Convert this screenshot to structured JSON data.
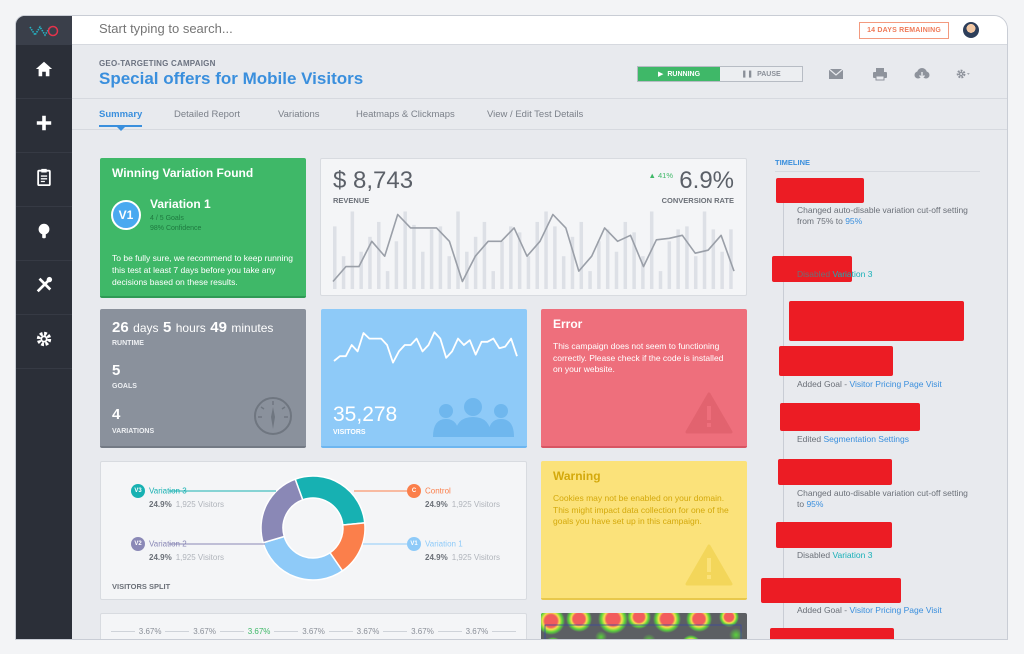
{
  "topbar": {
    "search_placeholder": "Start typing to search...",
    "days_remaining": "14 DAYS REMAINING"
  },
  "header": {
    "campaign_type": "GEO-TARGETING CAMPAIGN",
    "campaign_title": "Special offers for Mobile Visitors",
    "running_label": "RUNNING",
    "pause_label": "PAUSE"
  },
  "sidebar": {
    "items": [
      {
        "icon": "home-icon"
      },
      {
        "icon": "plus-icon"
      },
      {
        "icon": "clipboard-icon"
      },
      {
        "icon": "lightbulb-icon"
      },
      {
        "icon": "tools-icon"
      },
      {
        "icon": "gear-icon"
      }
    ]
  },
  "tabs": [
    {
      "label": "Summary",
      "active": true
    },
    {
      "label": "Detailed Report"
    },
    {
      "label": "Variations"
    },
    {
      "label": "Heatmaps & Clickmaps"
    },
    {
      "label": "View / Edit Test Details"
    }
  ],
  "winning": {
    "title": "Winning Variation Found",
    "badge": "V1",
    "name": "Variation 1",
    "goals": "4 / 5 Goals",
    "confidence": "98% Confidence",
    "message": "To be fully sure, we recommend to keep running this test at least 7 days before you take any decisions based on these results."
  },
  "revenue": {
    "value": "$ 8,743",
    "label": "REVENUE",
    "conversion_value": "6.9%",
    "conversion_label": "CONVERSION RATE",
    "delta": "41%"
  },
  "stats": {
    "runtime_days": "26",
    "runtime_days_unit": "days",
    "runtime_hours": "5",
    "runtime_hours_unit": "hours",
    "runtime_minutes": "49",
    "runtime_minutes_unit": "minutes",
    "runtime_label": "RUNTIME",
    "goals": "5",
    "goals_label": "GOALS",
    "variations": "4",
    "variations_label": "VARIATIONS"
  },
  "visitors": {
    "value": "35,278",
    "label": "VISITORS"
  },
  "error": {
    "title": "Error",
    "message": "This campaign does not seem to functioning correctly. Please check if the code is installed on your website."
  },
  "warning": {
    "title": "Warning",
    "message": "Cookies may not be enabled on your domain. This might impact data collection for one of the goals you have set up in this campaign."
  },
  "split": {
    "label": "VISITORS SPLIT",
    "variations": [
      {
        "badge": "V3",
        "name": "Variation 3",
        "percent": "24.9%",
        "visitors": "1,925 Visitors",
        "color": "#17b1b2"
      },
      {
        "badge": "C",
        "name": "Control",
        "percent": "24.9%",
        "visitors": "1,925 Visitors",
        "color": "#fb7f4b"
      },
      {
        "badge": "V2",
        "name": "Variation 2",
        "percent": "24.9%",
        "visitors": "1,925 Visitors",
        "color": "#8a88b6"
      },
      {
        "badge": "V1",
        "name": "Variation 1",
        "percent": "24.9%",
        "visitors": "1,925 Visitors",
        "color": "#8ecaf8"
      }
    ]
  },
  "percent_row": [
    "3.67%",
    "3.67%",
    "3.67%",
    "3.67%",
    "3.67%",
    "3.67%",
    "3.67%"
  ],
  "timeline": {
    "title": "TIMELINE",
    "items": [
      {
        "text": "Changed auto-disable variation cut-off setting  from 75% to ",
        "link": "95%"
      },
      {
        "text": "Disabled ",
        "link": "Variation 3"
      },
      {
        "text": "Added Goal - ",
        "link": "Visitor Pricing Page Visit"
      },
      {
        "text": "Edited ",
        "link": "Segmentation Settings"
      },
      {
        "text": "Changed auto-disable variation cut-off setting to ",
        "link": "95%"
      },
      {
        "text": "Disabled ",
        "link": "Variation 3"
      },
      {
        "text": "Added Goal - ",
        "link": "Visitor Pricing Page Visit"
      }
    ]
  },
  "colors": {
    "accent": "#3a8fdd",
    "success": "#3fb868",
    "error": "#ee6f7c",
    "warning": "#fbe27a",
    "info": "#8ecaf8",
    "neutral": "#8a919c"
  },
  "chart_data": [
    {
      "type": "line",
      "title": "Revenue",
      "series": [
        {
          "name": "conversion-trend",
          "values": [
            5,
            15,
            15,
            32,
            22,
            50,
            41,
            41,
            41,
            32,
            5,
            22,
            32,
            32,
            41,
            22,
            32,
            50,
            41,
            12,
            22,
            41,
            32,
            36,
            15,
            33,
            34,
            36,
            24,
            26,
            36,
            12
          ]
        },
        {
          "name": "revenue-bars",
          "values": [
            42,
            22,
            52,
            25,
            35,
            45,
            12,
            32,
            52,
            43,
            25,
            40,
            42,
            22,
            52,
            25,
            35,
            45,
            12,
            32,
            42,
            38,
            22,
            45,
            52,
            42,
            22,
            35,
            45,
            12,
            32,
            40,
            25,
            45,
            38,
            22,
            52,
            12,
            32,
            40,
            42,
            22,
            52,
            40,
            25,
            40
          ]
        }
      ]
    },
    {
      "type": "line",
      "title": "Visitors",
      "series": [
        {
          "name": "visitors-trend",
          "values": [
            10,
            16,
            16,
            30,
            22,
            45,
            38,
            38,
            38,
            30,
            8,
            22,
            30,
            30,
            38,
            22,
            30,
            46,
            38,
            14,
            22,
            38,
            30,
            36,
            18,
            34,
            34,
            38,
            26,
            28,
            38,
            16
          ]
        }
      ]
    },
    {
      "type": "pie",
      "title": "VISITORS SPLIT",
      "categories": [
        "Variation 3",
        "Control",
        "Variation 1",
        "Variation 2"
      ],
      "values": [
        29,
        17,
        30,
        24
      ]
    }
  ]
}
